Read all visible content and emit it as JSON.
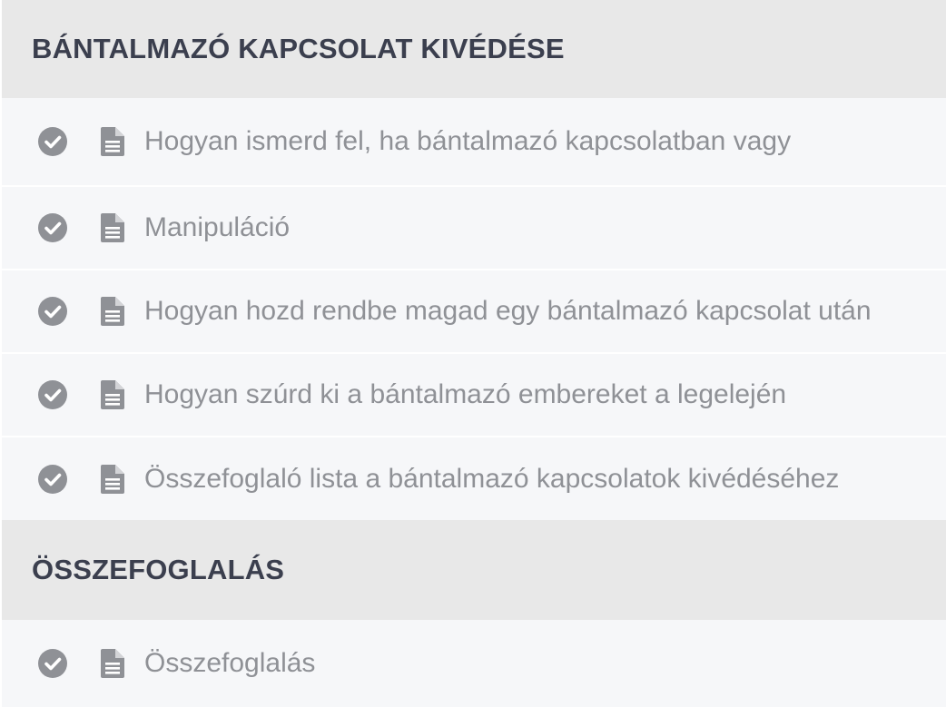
{
  "sections": [
    {
      "title": "BÁNTALMAZÓ KAPCSOLAT KIVÉDÉSE",
      "lessons": [
        {
          "title": "Hogyan ismerd fel, ha bántalmazó kapcsolatban vagy"
        },
        {
          "title": "Manipuláció"
        },
        {
          "title": "Hogyan hozd rendbe magad egy bántalmazó kapcsolat után"
        },
        {
          "title": "Hogyan szúrd ki a bántalmazó embereket a legelején"
        },
        {
          "title": "Összefoglaló lista a bántalmazó kapcsolatok kivédéséhez"
        }
      ]
    },
    {
      "title": "ÖSSZEFOGLALÁS",
      "lessons": [
        {
          "title": "Összefoglalás"
        }
      ]
    }
  ],
  "icons": {
    "completed": "check-circle-icon",
    "lesson_type": "document-icon"
  },
  "colors": {
    "header_bg": "#e8e8e8",
    "header_text": "#3b3f4e",
    "row_bg": "#f6f7f9",
    "row_text": "#8f9196",
    "icon": "#8f9196"
  }
}
